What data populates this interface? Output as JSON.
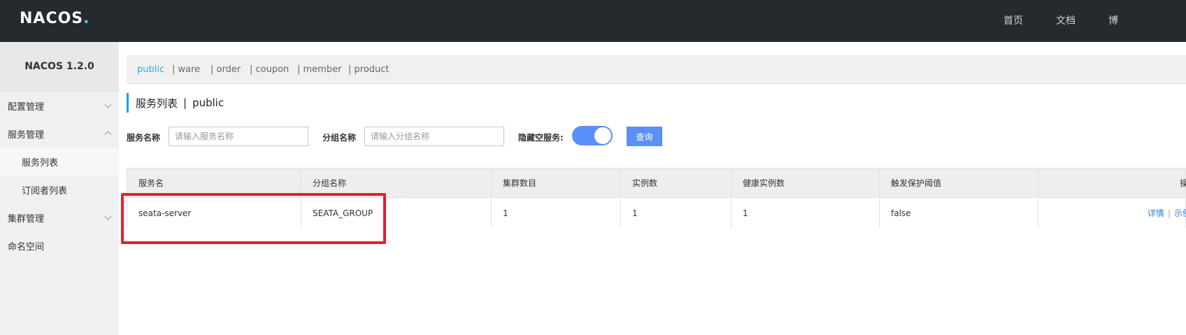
{
  "header": {
    "logo_main": "NACOS",
    "logo_dot": ".",
    "nav": [
      "首页",
      "文档",
      "博"
    ]
  },
  "sidebar": {
    "version": "NACOS 1.2.0",
    "items": [
      {
        "label": "配置管理"
      },
      {
        "label": "服务管理"
      },
      {
        "label": "服务列表"
      },
      {
        "label": "订阅者列表"
      },
      {
        "label": "集群管理"
      },
      {
        "label": "命名空间"
      }
    ]
  },
  "namespaces": [
    "public",
    "| ware",
    "| order",
    "| coupon",
    "| member",
    "| product"
  ],
  "page": {
    "title": "服务列表",
    "separator": "|",
    "namespace": "public"
  },
  "search": {
    "service_label": "服务名称",
    "service_placeholder": "请输入服务名称",
    "group_label": "分组名称",
    "group_placeholder": "请输入分组名称",
    "hide_empty_label": "隐藏空服务:",
    "hide_empty": true,
    "query_label": "查询"
  },
  "table": {
    "columns": [
      "服务名",
      "分组名称",
      "集群数目",
      "实例数",
      "健康实例数",
      "触发保护阈值",
      "操作"
    ],
    "rows": [
      {
        "name": "seata-server",
        "group": "SEATA_GROUP",
        "clusters": "1",
        "instances": "1",
        "healthy": "1",
        "threshold": "false",
        "op_detail": "详情",
        "op_sep": "|",
        "op_sample": "示例代码"
      }
    ]
  },
  "colors": {
    "header_bg": "#252a2f",
    "accent": "#5b8ff9",
    "namespace_active": "#33b0d6",
    "highlight": "#e6202c"
  }
}
